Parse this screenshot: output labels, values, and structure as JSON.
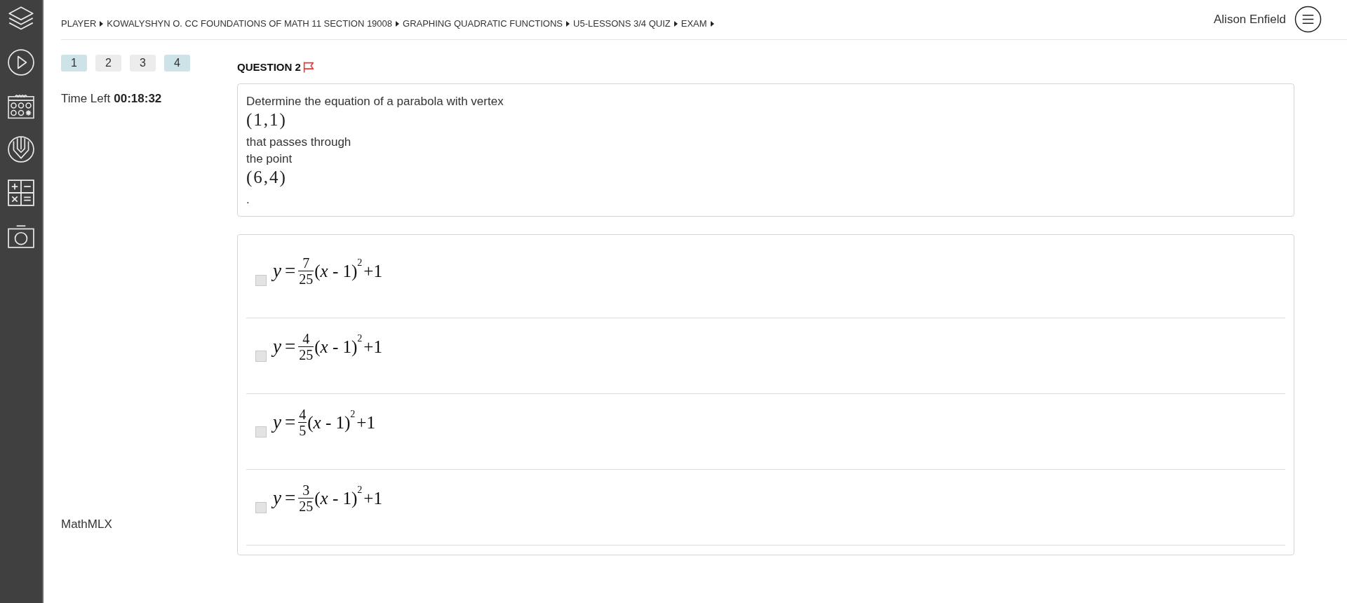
{
  "breadcrumb": [
    "PLAYER",
    "KOWALYSHYN O. CC FOUNDATIONS OF MATH 11 SECTION 19008",
    "GRAPHING QUADRATIC FUNCTIONS",
    "U5-LESSONS 3/4 QUIZ",
    "EXAM"
  ],
  "user": {
    "name": "Alison Enfield"
  },
  "question_nav": [
    {
      "label": "1",
      "answered": true
    },
    {
      "label": "2",
      "answered": false
    },
    {
      "label": "3",
      "answered": false
    },
    {
      "label": "4",
      "answered": true
    }
  ],
  "timer": {
    "label": "Time Left",
    "value": "00:18:32"
  },
  "footer_label": "MathMLX",
  "question": {
    "title": "QUESTION 2",
    "lines": [
      {
        "kind": "text",
        "text": "Determine the equation of a parabola with vertex"
      },
      {
        "kind": "math",
        "text": "(1,1)"
      },
      {
        "kind": "text",
        "text": "that passes through"
      },
      {
        "kind": "text",
        "text": "the point"
      },
      {
        "kind": "math",
        "text": "(6,4)"
      },
      {
        "kind": "text",
        "text": "."
      }
    ]
  },
  "answers": [
    {
      "checked": false,
      "formula": {
        "lhs": "y",
        "relation": "=",
        "numerator": "7",
        "denominator": "25",
        "body": "(*x* - 1)",
        "exponent": "2",
        "tail": "+1"
      }
    },
    {
      "checked": false,
      "formula": {
        "lhs": "y",
        "relation": "=",
        "numerator": "4",
        "denominator": "25",
        "body": "(*x* - 1)",
        "exponent": "2",
        "tail": "+1"
      }
    },
    {
      "checked": false,
      "formula": {
        "lhs": "y",
        "relation": "=",
        "numerator": "4",
        "denominator": "5",
        "body": "(*x* - 1)",
        "exponent": "2",
        "tail": "+1"
      }
    },
    {
      "checked": false,
      "formula": {
        "lhs": "y",
        "relation": "=",
        "numerator": "3",
        "denominator": "25",
        "body": "(*x* - 1)",
        "exponent": "2",
        "tail": "+1"
      }
    }
  ]
}
